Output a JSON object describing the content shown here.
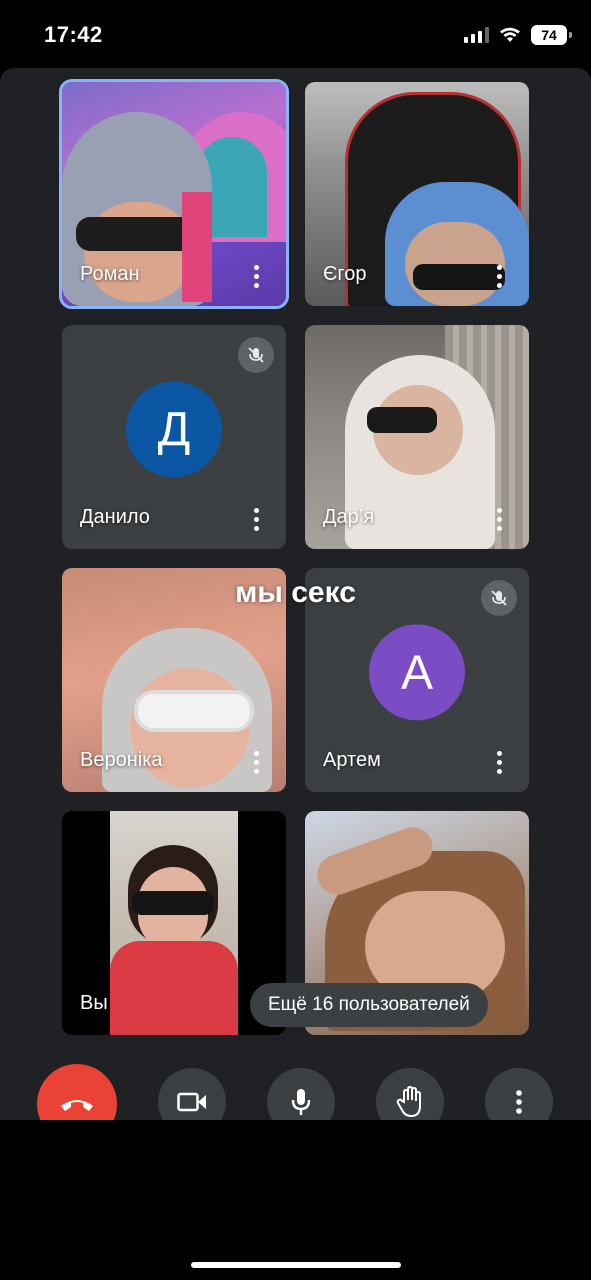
{
  "status": {
    "time": "17:42",
    "battery": "74"
  },
  "overlay_caption": "мы секс",
  "tiles": [
    {
      "name": "Роман",
      "active": true
    },
    {
      "name": "Єгор"
    },
    {
      "name": "Данило",
      "avatar_letter": "Д",
      "avatar_color": "#0b57a4",
      "muted": true
    },
    {
      "name": "Дар’я"
    },
    {
      "name": "Вероніка"
    },
    {
      "name": "Артем",
      "avatar_letter": "А",
      "avatar_color": "#7b4cc4",
      "muted": true
    },
    {
      "name": "Вы"
    },
    {
      "name": ""
    }
  ],
  "more_users_label": "Ещё 16 пользователей",
  "controls": [
    "end-call-icon",
    "camera-icon",
    "microphone-icon",
    "raise-hand-icon",
    "more-vertical-icon"
  ]
}
